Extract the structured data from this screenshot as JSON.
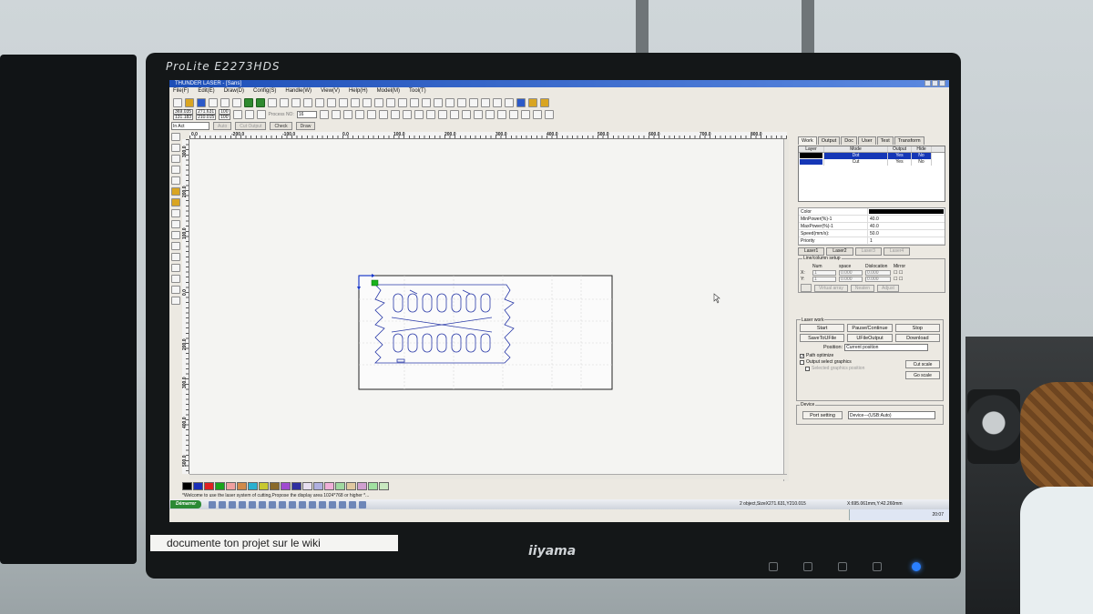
{
  "monitor": {
    "model": "ProLite E2273HDS",
    "brand": "iiyama",
    "sticker": "documente ton projet sur le wiki"
  },
  "app": {
    "title": "THUNDER LASER - [Sans]"
  },
  "menu": [
    "File(F)",
    "Edit(E)",
    "Draw(D)",
    "Config(S)",
    "Handle(W)",
    "View(V)",
    "Help(H)",
    "Model(M)",
    "Tool(T)"
  ],
  "coords": {
    "x": "369.035",
    "y": "131.183",
    "w": "271.631",
    "h": "210.015",
    "unit": "mm",
    "pct1": "100",
    "pct2": "100"
  },
  "process": {
    "label": "Process NO:",
    "value": "16"
  },
  "toolbar3": {
    "layer": "In Act",
    "buttons": [
      "Auto",
      "Cut Output",
      "Check",
      "Draw"
    ]
  },
  "ruler_x": [
    "0.0",
    "-200.0",
    "-100.0",
    "0.0",
    "100.0",
    "200.0",
    "300.0",
    "400.0",
    "500.0",
    "600.0",
    "700.0",
    "800.0"
  ],
  "ruler_y": [
    "300.0",
    "200.0",
    "100.0",
    "0.0",
    "200.0",
    "300.0",
    "400.0",
    "500.0"
  ],
  "palette": [
    "#000000",
    "#1a2fb8",
    "#e02020",
    "#19a51c",
    "#f0a0a0",
    "#d08a4a",
    "#2bb0d0",
    "#c8c830",
    "#8a6a2a",
    "#a04ad0",
    "#3030a0",
    "#e8e0f0",
    "#b0b0e0",
    "#f0b0d8",
    "#a0d8a0",
    "#e0c8a0",
    "#d0a0d0",
    "#a0e0a0",
    "#c8e8c0"
  ],
  "status_message": "*Welcome to use the laser system of cutting,Propose the display area 1024*768 or higher *...",
  "right_panel": {
    "tabs": [
      "Work",
      "Output",
      "Doc",
      "User",
      "Test",
      "Transform"
    ],
    "layer_headers": [
      "Layer",
      "Mode",
      "Output",
      "Hide"
    ],
    "layers": [
      {
        "color": "#000000",
        "mode": "Dot",
        "output": "Yes",
        "hide": "No"
      },
      {
        "color": "#1537b6",
        "mode": "Cut",
        "output": "Yes",
        "hide": "No"
      }
    ],
    "props": [
      {
        "label": "Color",
        "value": ""
      },
      {
        "label": "MinPower(%)-1",
        "value": "40.0"
      },
      {
        "label": "MaxPower(%)-1",
        "value": "40.0"
      },
      {
        "label": "Speed(mm/s):",
        "value": "50.0"
      },
      {
        "label": "Priority",
        "value": "1"
      }
    ],
    "laser_tabs": [
      "Laser1",
      "Laser2",
      "Laser3",
      "Laser4"
    ],
    "line_column": {
      "title": "Line/column setup",
      "headers": [
        "Num",
        "space",
        "Dislocation",
        "Mirror"
      ],
      "x_label": "X:",
      "y_label": "Y:",
      "num": "1",
      "space": "0.000",
      "dislocation": "0.000",
      "buttons": [
        "Virtual array",
        "Neaten",
        "Adjust"
      ]
    }
  },
  "laser_work": {
    "title": "Laser work",
    "buttons_row1": [
      "Start",
      "Pause/Continue",
      "Stop"
    ],
    "buttons_row2": [
      "SaveToUFile",
      "UFileOutput",
      "Download"
    ],
    "position_label": "Position:",
    "position_value": "Current position",
    "checks": [
      {
        "label": "Path optimize",
        "checked": true
      },
      {
        "label": "Output select graphics",
        "checked": false
      },
      {
        "label": "Selected graphics position",
        "checked": false
      }
    ],
    "cut_scale": "Cut scale",
    "go_scale": "Go scale"
  },
  "device": {
    "title": "Device",
    "port_button": "Port setting",
    "value": "Device---(USB:Auto)"
  },
  "taskbar": {
    "start": "Démarrer",
    "status": "2 object,SizeX271.631,Y210.015",
    "coord": "X:695.061mm,Y:42.260mm",
    "time": "20:07"
  }
}
